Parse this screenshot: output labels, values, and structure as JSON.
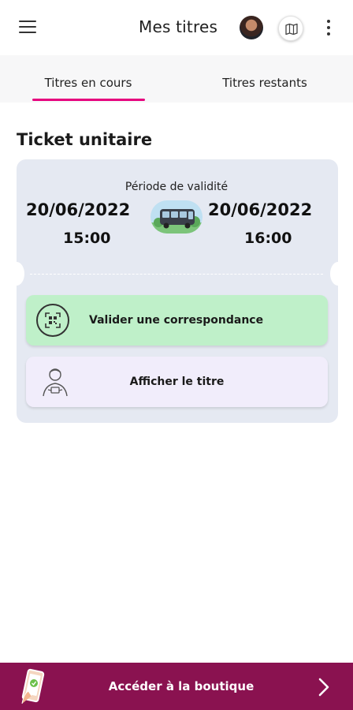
{
  "header": {
    "title": "Mes titres",
    "menu_icon": "hamburger-menu-icon",
    "avatar_icon": "user-avatar",
    "map_icon": "map-icon",
    "more_icon": "more-vertical-icon"
  },
  "tabs": [
    {
      "label": "Titres en cours",
      "active": true
    },
    {
      "label": "Titres restants",
      "active": false
    }
  ],
  "section": {
    "title": "Ticket unitaire"
  },
  "ticket": {
    "validity_label": "Période de validité",
    "start_date": "20/06/2022",
    "start_time": "15:00",
    "end_date": "20/06/2022",
    "end_time": "16:00",
    "vehicle_icon": "bus-icon"
  },
  "actions": {
    "validate_label": "Valider une correspondance",
    "validate_icon": "qr-code-icon",
    "show_label": "Afficher le titre",
    "show_icon": "inspector-icon"
  },
  "bottom_bar": {
    "label": "Accéder à la boutique",
    "icon": "phone-ticket-icon",
    "chevron_icon": "chevron-right-icon"
  },
  "colors": {
    "accent": "#e6007e",
    "bottom_bar": "#8a1250",
    "ticket_bg": "#e5e9f2",
    "validate_bg": "#bff0c9",
    "show_bg": "#f1edfb"
  }
}
